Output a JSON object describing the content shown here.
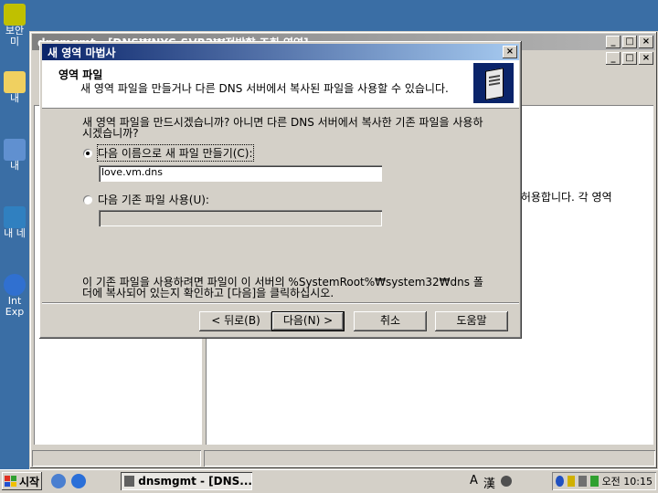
{
  "desktop": {
    "icons": [
      {
        "label": "보안",
        "label2": "미",
        "color": "#c0c000"
      },
      {
        "label": "내",
        "color": "#f0d060"
      },
      {
        "label": "내 ",
        "color": "#6090d0"
      },
      {
        "label": "내 네",
        "color": "#3080c0"
      },
      {
        "label": "Int",
        "label2": "Exp",
        "color": "#3070d0"
      }
    ]
  },
  "mmc": {
    "title": "dnsmgmt - [DNS₩NYC-SVR2₩정방향 조회 영역]",
    "min": "_",
    "max": "□",
    "close": "×",
    "right_text": "록 허용합니다. 각 영역"
  },
  "wizard": {
    "title": "새 영역 마법사",
    "close": "×",
    "header_title": "영역 파일",
    "header_subtitle": "새 영역 파일을 만들거나 다른 DNS 서버에서 복사된 파일을 사용할 수 있습니다.",
    "intro": "새 영역 파일을 만드시겠습니까? 아니면 다른 DNS 서버에서 복사한 기존 파일을 사용하시겠습니까?",
    "option_create": "다음 이름으로 새 파일 만들기(C):",
    "create_value": "love.vm.dns",
    "option_existing": "다음 기존 파일 사용(U):",
    "existing_value": "",
    "note": "이 기존 파일을 사용하려면 파일이 이 서버의 %SystemRoot%₩system32₩dns 폴더에 복사되어 있는지 확인하고 [다음]을 클릭하십시오.",
    "buttons": {
      "back": "< 뒤로(B)",
      "next": "다음(N) >",
      "cancel": "취소",
      "help": "도움말"
    }
  },
  "taskbar": {
    "start": "시작",
    "task": "dnsmgmt - [DNS...",
    "ime_a": "A",
    "ime_han": "漢",
    "clock": "오전 10:15"
  }
}
